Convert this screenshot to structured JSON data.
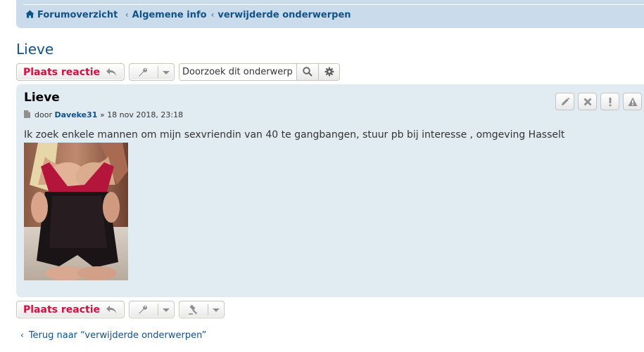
{
  "breadcrumbs": [
    {
      "label": "Forumoverzicht"
    },
    {
      "label": "Algemene info"
    },
    {
      "label": "verwijderde onderwerpen"
    }
  ],
  "breadcrumb_separator": "‹",
  "topic": {
    "title": "Lieve"
  },
  "actions": {
    "reply_label": "Plaats reactie",
    "search_placeholder": "Doorzoek dit onderwerp…",
    "search_value": "Doorzoek dit onderwerp"
  },
  "post": {
    "title": "Lieve",
    "author_prefix": "door",
    "author": "Daveke31",
    "date_separator": "»",
    "date": "18 nov 2018, 23:18",
    "text": "Ik zoek enkele mannen om mijn sexvriendin van 40 te gangbangen, stuur pb bij interesse , omgeving Hasselt",
    "action_icons": [
      "edit-icon",
      "delete-icon",
      "report-icon",
      "warn-icon"
    ]
  },
  "footer": {
    "back_chevron": "‹",
    "back_link": "Terug naar “verwijderde onderwerpen”"
  },
  "colors": {
    "navbar_bg": "#cadceb",
    "post_bg": "#e1ebf2",
    "link": "#105289",
    "reply_red": "#d31141"
  }
}
